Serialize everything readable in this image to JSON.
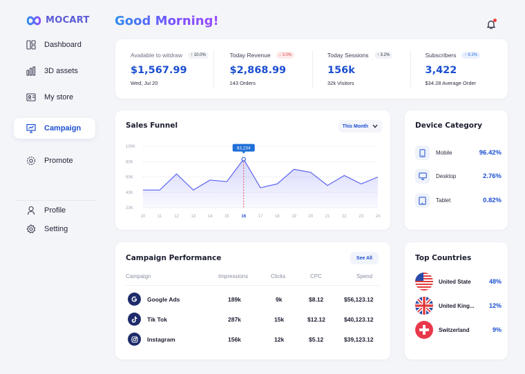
{
  "brand": {
    "name": "MOCART",
    "accent": "#1b4fd0"
  },
  "greeting": "Good Morning!",
  "sidebar": {
    "items": [
      {
        "label": "Dashboard",
        "icon": "dashboard-icon"
      },
      {
        "label": "3D assets",
        "icon": "bar-chart-icon"
      },
      {
        "label": "My store",
        "icon": "store-card-icon"
      },
      {
        "label": "Campaign",
        "icon": "presentation-icon",
        "active": true
      },
      {
        "label": "Promote",
        "icon": "promote-gear-icon"
      }
    ],
    "bottom": [
      {
        "label": "Profile",
        "icon": "user-icon"
      },
      {
        "label": "Setting",
        "icon": "settings-icon"
      }
    ]
  },
  "stats": [
    {
      "label": "Available to witdraw",
      "badge": "10.0%",
      "trend": "up",
      "value": "$1,567.99",
      "sub": "Wed, Jui 20"
    },
    {
      "label": "Today Revenue",
      "badge": "3.0%",
      "trend": "down",
      "value": "$2,868.99",
      "sub": "143 Orders"
    },
    {
      "label": "Today Sessions",
      "badge": "3.2%",
      "trend": "up",
      "value": "156k",
      "sub": "32k Visitors"
    },
    {
      "label": "Subscribers",
      "badge": "8.3%",
      "trend": "up-blue",
      "value": "3,422",
      "sub": "$34.28 Average Order"
    }
  ],
  "sales_funnel": {
    "title": "Sales Funnel",
    "period": "This Month",
    "tooltip": "83,234",
    "highlight": "16"
  },
  "chart_data": {
    "type": "area",
    "title": "Sales Funnel",
    "x": [
      "10",
      "11",
      "12",
      "13",
      "14",
      "15",
      "16",
      "17",
      "18",
      "19",
      "20",
      "21",
      "22",
      "23",
      "24"
    ],
    "values": [
      43000,
      43000,
      64000,
      43000,
      56000,
      54000,
      83234,
      46000,
      51000,
      70000,
      66000,
      49000,
      62000,
      51000,
      60000
    ],
    "yticks": [
      "100K",
      "80K",
      "60K",
      "40K",
      "20K"
    ],
    "ylim": [
      20000,
      100000
    ],
    "grid": true,
    "color": "#5b62f0"
  },
  "device_category": {
    "title": "Device Category",
    "items": [
      {
        "label": "Mobile",
        "value": "96.42%",
        "icon": "mobile-icon"
      },
      {
        "label": "Desktop",
        "value": "2.76%",
        "icon": "desktop-icon"
      },
      {
        "label": "Tablet",
        "value": "0.82%",
        "icon": "tablet-icon"
      }
    ]
  },
  "campaign_performance": {
    "title": "Campaign Performance",
    "see_all": "See All",
    "columns": [
      "Campaign",
      "Impressions",
      "Clicks",
      "CPC",
      "Spend"
    ],
    "rows": [
      {
        "name": "Google Ads",
        "icon": "google-icon",
        "impressions": "189k",
        "clicks": "9k",
        "cpc": "$8.12",
        "spend": "$56,123.12"
      },
      {
        "name": "Tik Tok",
        "icon": "tiktok-icon",
        "impressions": "287k",
        "clicks": "15k",
        "cpc": "$12.12",
        "spend": "$40,123.12"
      },
      {
        "name": "Instagram",
        "icon": "instagram-icon",
        "impressions": "156k",
        "clicks": "12k",
        "cpc": "$5.12",
        "spend": "$39,123.12"
      }
    ]
  },
  "top_countries": {
    "title": "Top Countries",
    "items": [
      {
        "name": "United State",
        "value": "48%",
        "flag": "us-flag-icon"
      },
      {
        "name": "United King...",
        "value": "12%",
        "flag": "uk-flag-icon"
      },
      {
        "name": "Switzerland",
        "value": "9%",
        "flag": "swiss-flag-icon"
      }
    ]
  }
}
